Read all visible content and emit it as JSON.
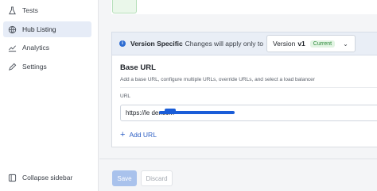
{
  "sidebar": {
    "items": [
      {
        "label": "Tests",
        "icon": "flask-icon"
      },
      {
        "label": "Hub Listing",
        "icon": "globe-icon",
        "active": true
      },
      {
        "label": "Analytics",
        "icon": "chart-line-icon"
      },
      {
        "label": "Settings",
        "icon": "pencil-icon"
      }
    ],
    "collapse_label": "Collapse sidebar"
  },
  "version_bar": {
    "label": "Version Specific",
    "text": "Changes will apply only to",
    "select_prefix": "Version",
    "select_value": "v1",
    "badge": "Current"
  },
  "base_url": {
    "title": "Base URL",
    "description": "Add a base URL, configure multiple URLs, override URLs, and select a load balancer",
    "field_label": "URL",
    "url_value": "https://le                                                  der.com",
    "add_label": "Add URL"
  },
  "footer": {
    "save_label": "Save",
    "discard_label": "Discard"
  },
  "colors": {
    "accent": "#2d5fc4",
    "active_bg": "#e6ecf7",
    "badge_green": "#2d8a3a"
  }
}
